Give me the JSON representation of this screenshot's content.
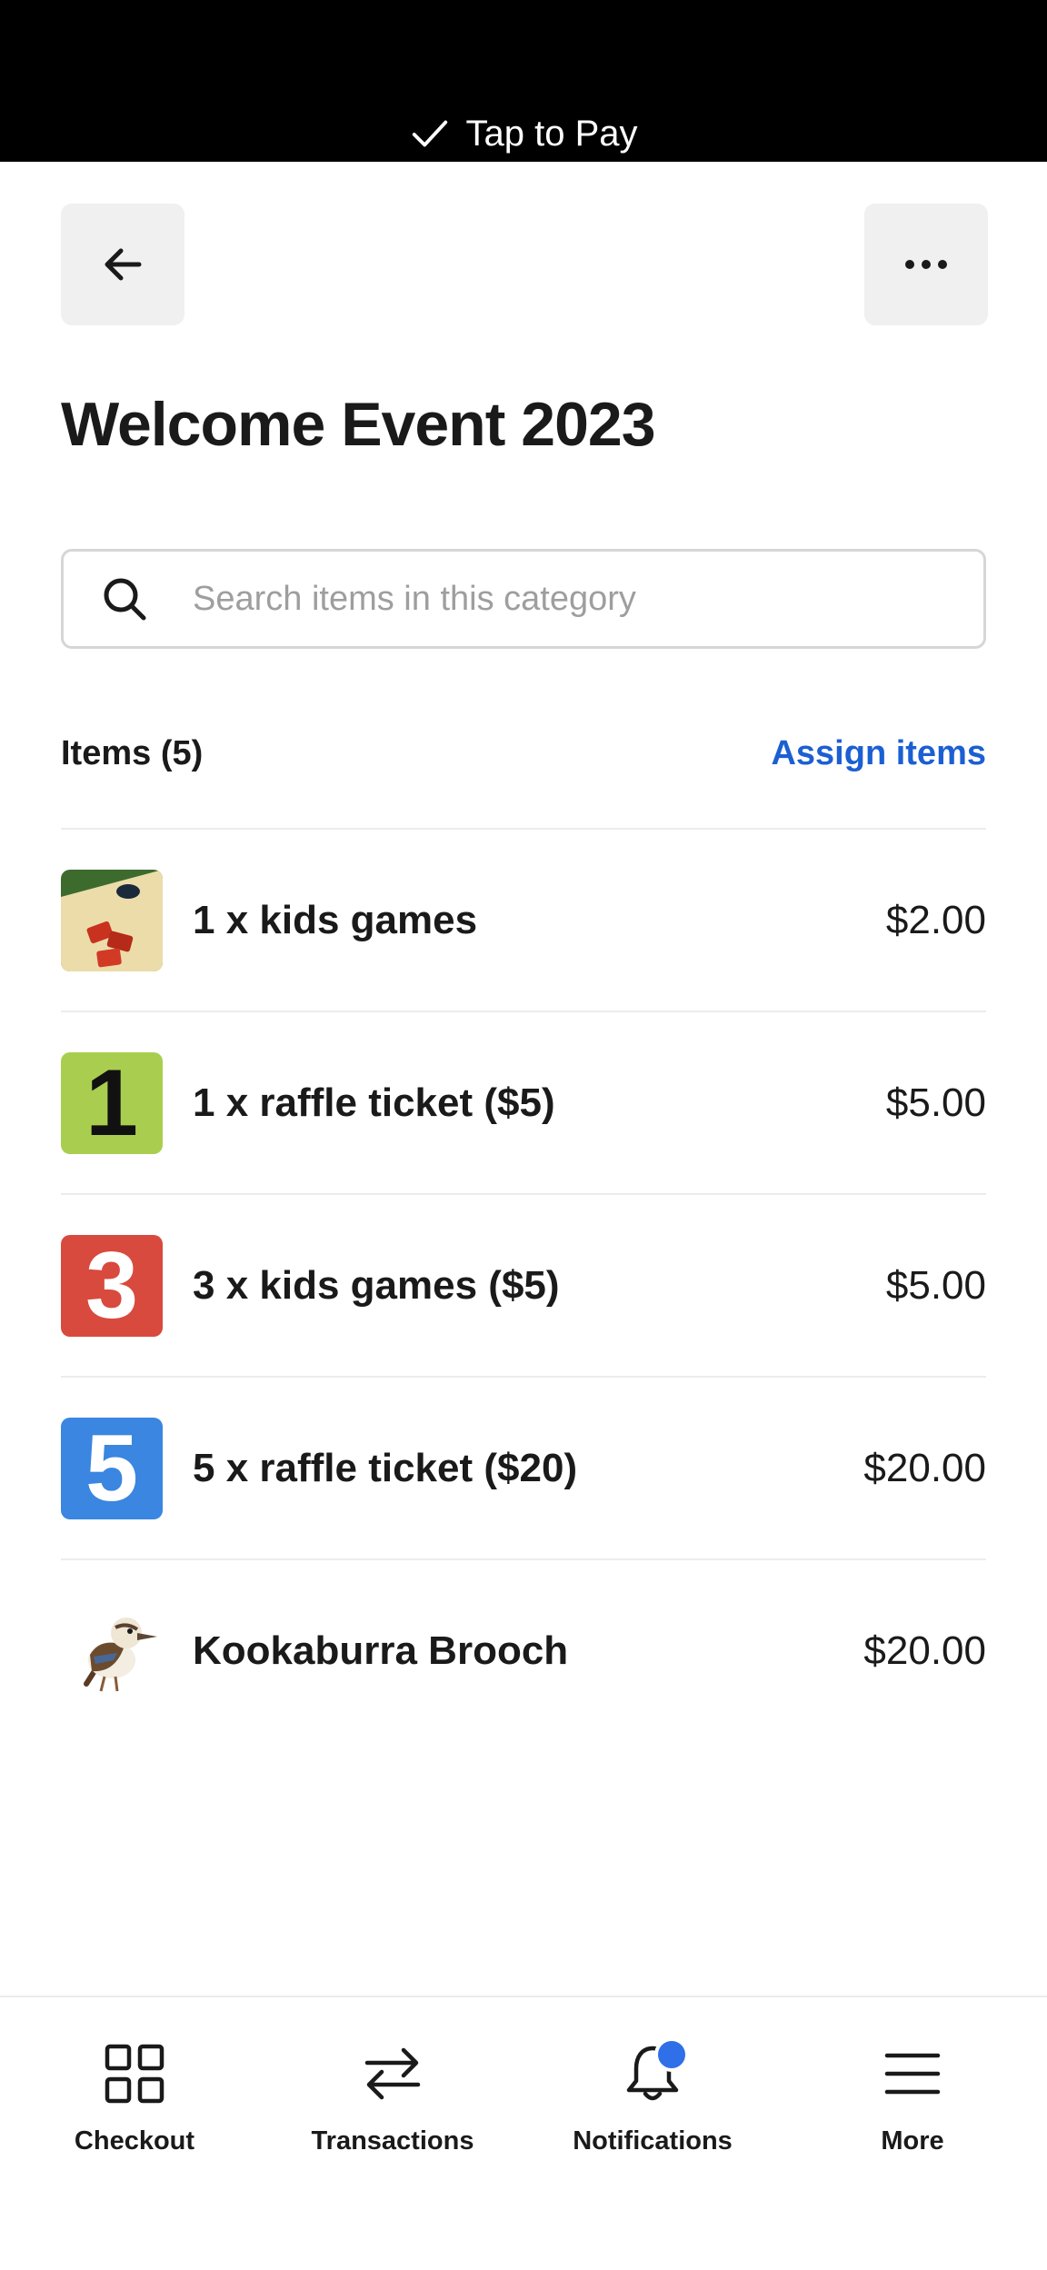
{
  "status_bar": {
    "label": "Tap to Pay"
  },
  "header": {
    "title": "Welcome Event 2023"
  },
  "search": {
    "placeholder": "Search items in this category",
    "value": ""
  },
  "items_section": {
    "count_label": "Items (5)",
    "assign_label": "Assign items"
  },
  "items": [
    {
      "name": "1 x kids games",
      "price": "$2.00",
      "thumb": "photo-cornhole"
    },
    {
      "name": "1 x raffle ticket ($5)",
      "price": "$5.00",
      "thumb_text": "1",
      "thumb_bg": "#a9ce4f",
      "thumb_fg": "#111111"
    },
    {
      "name": "3 x kids games ($5)",
      "price": "$5.00",
      "thumb_text": "3",
      "thumb_bg": "#d84a3d",
      "thumb_fg": "#ffffff"
    },
    {
      "name": "5 x raffle ticket ($20)",
      "price": "$20.00",
      "thumb_text": "5",
      "thumb_bg": "#3a86e0",
      "thumb_fg": "#ffffff"
    },
    {
      "name": "Kookaburra Brooch",
      "price": "$20.00",
      "thumb": "kookaburra-illustration"
    }
  ],
  "nav": [
    {
      "label": "Checkout",
      "icon": "grid-icon"
    },
    {
      "label": "Transactions",
      "icon": "swap-arrows-icon"
    },
    {
      "label": "Notifications",
      "icon": "bell-icon",
      "has_badge": true
    },
    {
      "label": "More",
      "icon": "menu-icon"
    }
  ],
  "colors": {
    "accent": "#1c5fd3",
    "badge": "#2f6fe8",
    "status_bar": "#000000"
  }
}
